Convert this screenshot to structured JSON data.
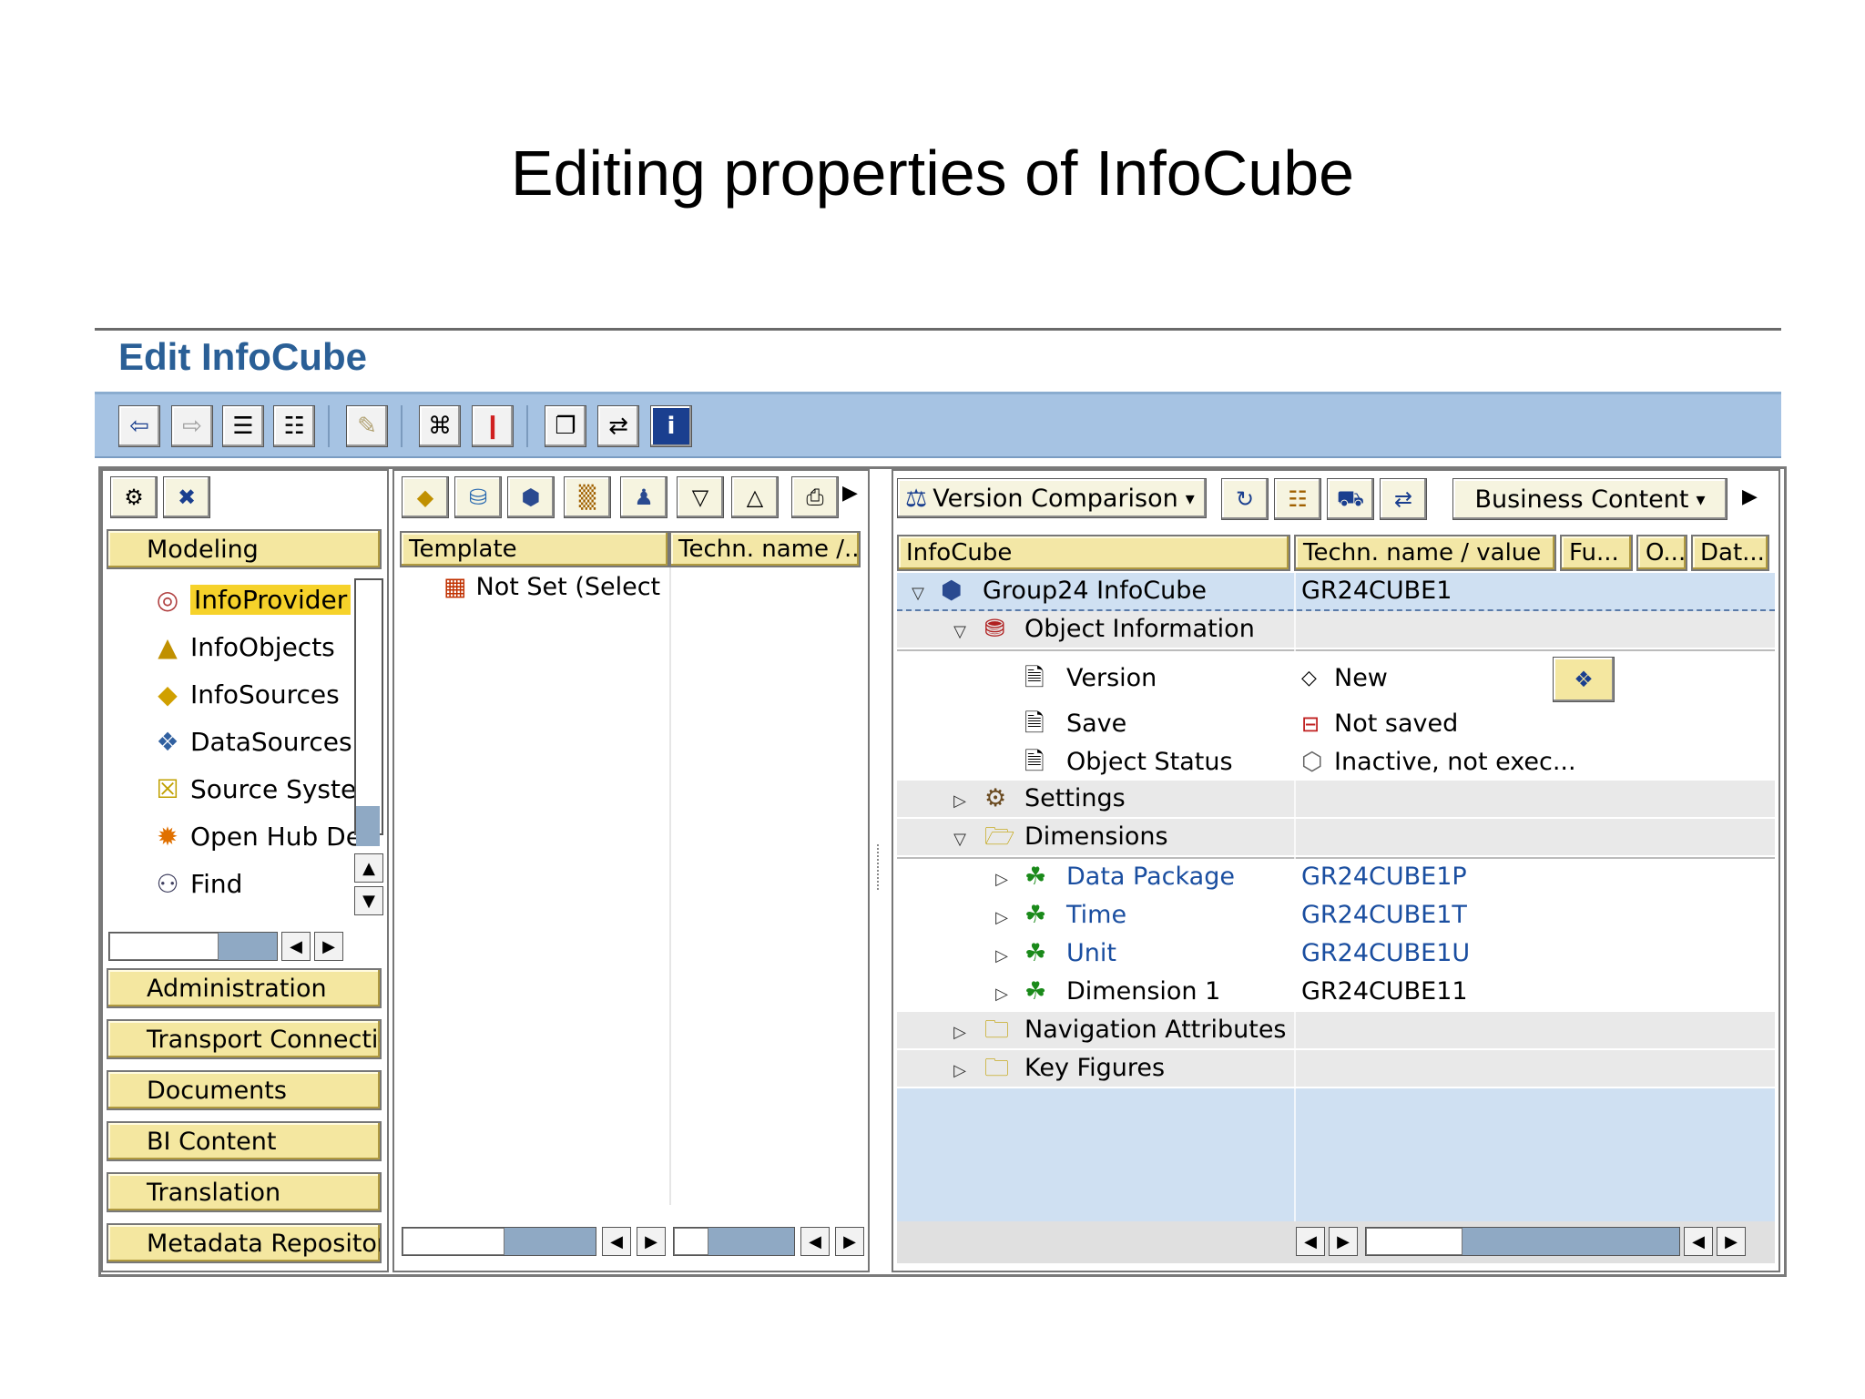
{
  "slide_title": "Editing properties of InfoCube",
  "app_title": "Edit InfoCube",
  "colors": {
    "toolbar": "#a6c3e3",
    "title": "#2a5f96",
    "nav_button": "#f4e7a0",
    "link": "#1a4ea0",
    "selected_row": "#cfe0f2"
  },
  "main_toolbar": {
    "icons": [
      "back-icon",
      "forward-icon",
      "display-list-icon",
      "tree-icon",
      "check-icon",
      "hierarchy-icon",
      "activate-icon",
      "copy-icon",
      "transfer-icon",
      "info-icon"
    ]
  },
  "left_pane": {
    "top_icons": [
      "settings-icon",
      "close-icon"
    ],
    "sections_top": [
      "Modeling"
    ],
    "tree": [
      {
        "label": "InfoProvider",
        "icon": "infoprovider-icon",
        "selected": true
      },
      {
        "label": "InfoObjects",
        "icon": "infoobjects-icon"
      },
      {
        "label": "InfoSources",
        "icon": "infosources-icon"
      },
      {
        "label": "DataSources",
        "icon": "datasources-icon"
      },
      {
        "label": "Source Syste",
        "icon": "source-system-icon"
      },
      {
        "label": "Open Hub De",
        "icon": "open-hub-icon"
      },
      {
        "label": "Find",
        "icon": "find-icon"
      }
    ],
    "sections_bottom": [
      "Administration",
      "Transport Connectio",
      "Documents",
      "BI Content",
      "Translation",
      "Metadata Repository"
    ]
  },
  "middle_pane": {
    "toolbar_icons": [
      "infosource-icon",
      "database-icon",
      "cube-icon",
      "multiprovider-icon",
      "person-icon",
      "expand-icon",
      "collapse-icon",
      "print-icon"
    ],
    "columns": [
      "Template",
      "Techn. name /..."
    ],
    "rows": [
      {
        "label": "Not Set (Select u",
        "icon": "table-icon"
      }
    ]
  },
  "right_pane": {
    "toolbar": {
      "version_comparison": "Version Comparison",
      "business_content": "Business Content"
    },
    "columns": [
      "InfoCube",
      "Techn. name / value",
      "Fu...",
      "O...",
      "Dat..."
    ],
    "rows": [
      {
        "label": "Group24 InfoCube",
        "value": "GR24CUBE1"
      },
      {
        "label": "Object Information",
        "value": ""
      },
      {
        "label": "Version",
        "value": "New"
      },
      {
        "label": "Save",
        "value": "Not saved"
      },
      {
        "label": "Object Status",
        "value": "Inactive, not exec..."
      },
      {
        "label": "Settings",
        "value": ""
      },
      {
        "label": "Dimensions",
        "value": ""
      },
      {
        "label": "Data Package",
        "value": "GR24CUBE1P"
      },
      {
        "label": "Time",
        "value": "GR24CUBE1T"
      },
      {
        "label": "Unit",
        "value": "GR24CUBE1U"
      },
      {
        "label": "Dimension 1",
        "value": "GR24CUBE11"
      },
      {
        "label": "Navigation Attributes",
        "value": ""
      },
      {
        "label": "Key Figures",
        "value": ""
      }
    ]
  }
}
